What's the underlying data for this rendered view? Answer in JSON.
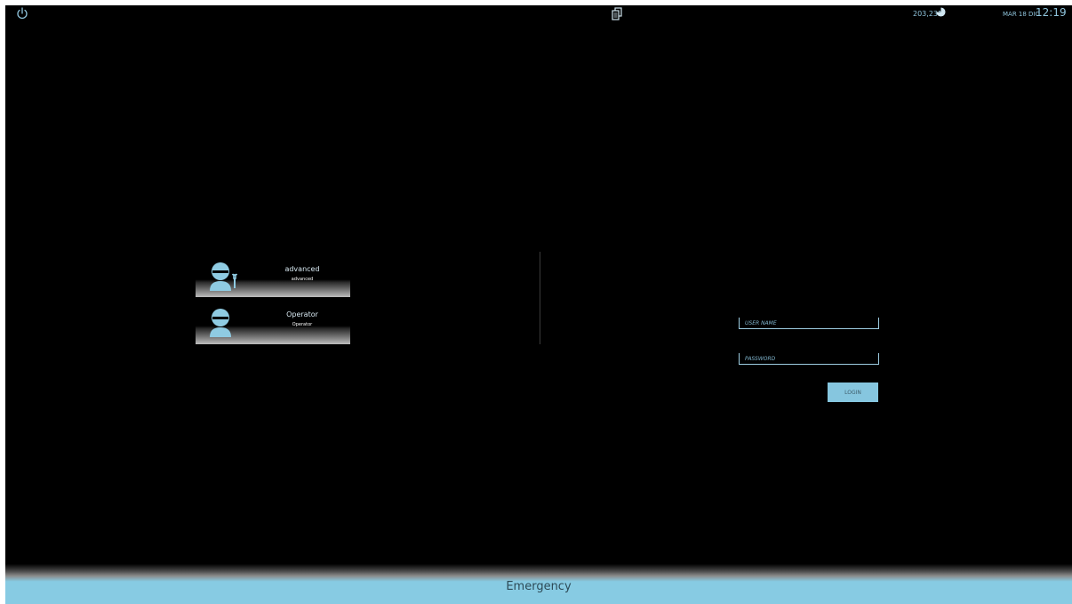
{
  "topbar": {
    "power_icon": "power-icon",
    "docs_icon": "documents-icon",
    "storage_value": "203,231",
    "storage_icon": "pie-icon",
    "date": "MAR 18 DIC",
    "time": "12:19"
  },
  "users": [
    {
      "name": "advanced",
      "role": "advanced",
      "icon": "technician-icon"
    },
    {
      "name": "Operator",
      "role": "Operator",
      "icon": "user-icon"
    }
  ],
  "login": {
    "username_placeholder": "USER NAME",
    "password_placeholder": "PASSWORD",
    "button_label": "LOGIN"
  },
  "emergency": {
    "label": "Emergency"
  },
  "colors": {
    "accent": "#86c6df",
    "background": "#000000",
    "text_light": "#d8e9f2"
  }
}
